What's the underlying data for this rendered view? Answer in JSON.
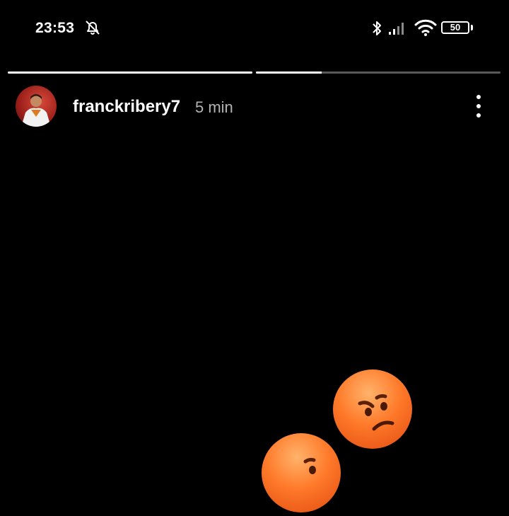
{
  "status_bar": {
    "time": "23:53",
    "battery_level": "50",
    "icons": [
      "bell-muted-icon",
      "bluetooth-icon",
      "signal-icon",
      "wifi-icon",
      "battery-icon"
    ]
  },
  "story": {
    "segments": [
      {
        "progress": 1.0
      },
      {
        "progress": 0.27
      }
    ],
    "username": "franckribery7",
    "time_ago": "5 min",
    "menu_icon": "more-vertical-icon",
    "stickers": [
      "pouting-face-emoji",
      "pouting-face-emoji"
    ]
  },
  "colors": {
    "background": "#000000",
    "progress_filled": "#ffffff",
    "progress_track": "#5a5a5a",
    "timestamp": "#b3b3b3",
    "emoji": "#ff7a2a"
  }
}
